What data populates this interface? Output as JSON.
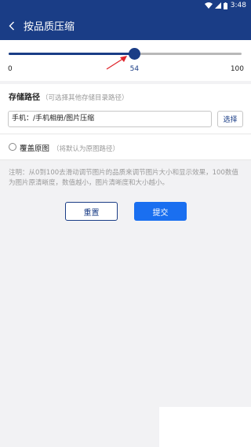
{
  "status_bar": {
    "time": "3:48",
    "icons": [
      "wifi-icon",
      "signal-icon",
      "battery-icon"
    ]
  },
  "app_bar": {
    "title": "按品质压缩",
    "back_icon": "chevron-left-icon"
  },
  "quality_slider": {
    "min_label": "0",
    "max_label": "100",
    "value": 54,
    "min": 0,
    "max": 100
  },
  "storage": {
    "title": "存储路径",
    "hint": "（可选择其他存储目录路径）",
    "path_value": "手机：/手机相册/图片压缩",
    "choose_label": "选择"
  },
  "overwrite": {
    "label": "覆盖原图",
    "hint": "（将默认为原图路径）",
    "checked": false
  },
  "note": "注明：从0到100去滑动调节图片的品质来调节图片大小和显示效果，100数值为图片原清晰度，数值越小，图片清晰度和大小越小。",
  "actions": {
    "reset_label": "重置",
    "submit_label": "提交"
  },
  "colors": {
    "primary": "#1a3d86",
    "accent": "#1a6ff0",
    "annotation_arrow": "#e0262c"
  }
}
